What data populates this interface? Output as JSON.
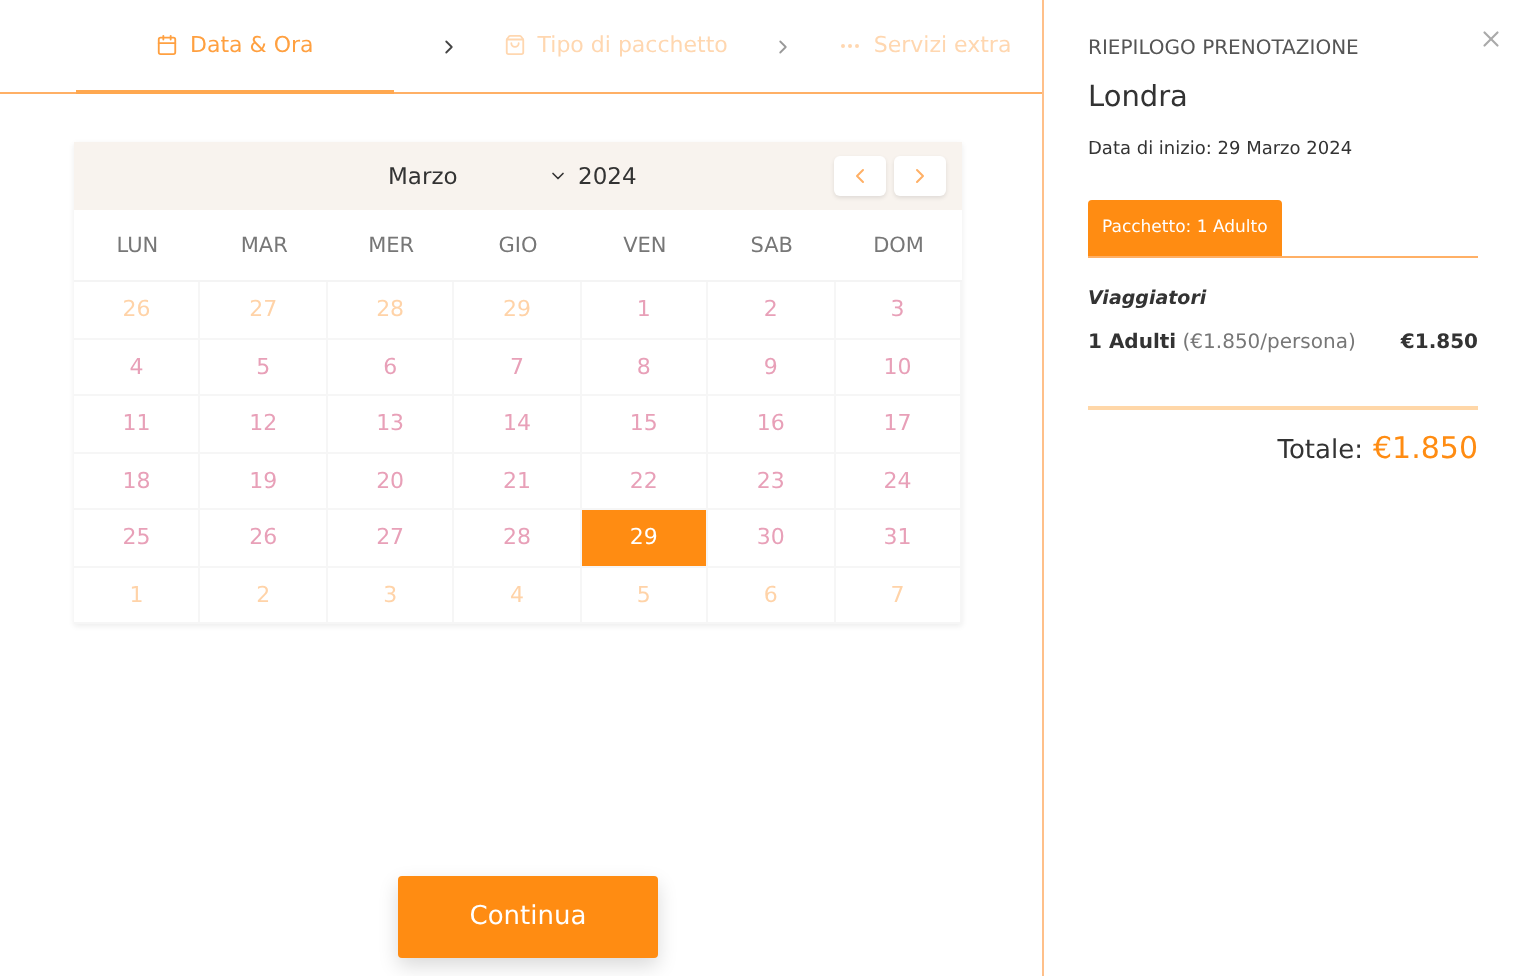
{
  "steps": [
    {
      "label": "Data & Ora",
      "kind": "calendar",
      "selected": true
    },
    {
      "label": "Tipo di pacchetto",
      "kind": "bag",
      "selected": false
    },
    {
      "label": "Servizi extra",
      "kind": "dots",
      "selected": false
    }
  ],
  "calendar": {
    "month": "Marzo",
    "year": "2024",
    "weekdays": [
      "LUN",
      "MAR",
      "MER",
      "GIO",
      "VEN",
      "SAB",
      "DOM"
    ],
    "weeks": [
      [
        {
          "day": "26",
          "outside": true,
          "selected": false
        },
        {
          "day": "27",
          "outside": true,
          "selected": false
        },
        {
          "day": "28",
          "outside": true,
          "selected": false
        },
        {
          "day": "29",
          "outside": true,
          "selected": false
        },
        {
          "day": "1",
          "outside": false,
          "selected": false
        },
        {
          "day": "2",
          "outside": false,
          "selected": false
        },
        {
          "day": "3",
          "outside": false,
          "selected": false
        }
      ],
      [
        {
          "day": "4",
          "outside": false,
          "selected": false
        },
        {
          "day": "5",
          "outside": false,
          "selected": false
        },
        {
          "day": "6",
          "outside": false,
          "selected": false
        },
        {
          "day": "7",
          "outside": false,
          "selected": false
        },
        {
          "day": "8",
          "outside": false,
          "selected": false
        },
        {
          "day": "9",
          "outside": false,
          "selected": false
        },
        {
          "day": "10",
          "outside": false,
          "selected": false
        }
      ],
      [
        {
          "day": "11",
          "outside": false,
          "selected": false
        },
        {
          "day": "12",
          "outside": false,
          "selected": false
        },
        {
          "day": "13",
          "outside": false,
          "selected": false
        },
        {
          "day": "14",
          "outside": false,
          "selected": false
        },
        {
          "day": "15",
          "outside": false,
          "selected": false
        },
        {
          "day": "16",
          "outside": false,
          "selected": false
        },
        {
          "day": "17",
          "outside": false,
          "selected": false
        }
      ],
      [
        {
          "day": "18",
          "outside": false,
          "selected": false
        },
        {
          "day": "19",
          "outside": false,
          "selected": false
        },
        {
          "day": "20",
          "outside": false,
          "selected": false
        },
        {
          "day": "21",
          "outside": false,
          "selected": false
        },
        {
          "day": "22",
          "outside": false,
          "selected": false
        },
        {
          "day": "23",
          "outside": false,
          "selected": false
        },
        {
          "day": "24",
          "outside": false,
          "selected": false
        }
      ],
      [
        {
          "day": "25",
          "outside": false,
          "selected": false
        },
        {
          "day": "26",
          "outside": false,
          "selected": false
        },
        {
          "day": "27",
          "outside": false,
          "selected": false
        },
        {
          "day": "28",
          "outside": false,
          "selected": false
        },
        {
          "day": "29",
          "outside": false,
          "selected": true
        },
        {
          "day": "30",
          "outside": false,
          "selected": false
        },
        {
          "day": "31",
          "outside": false,
          "selected": false
        }
      ],
      [
        {
          "day": "1",
          "outside": true,
          "selected": false
        },
        {
          "day": "2",
          "outside": true,
          "selected": false
        },
        {
          "day": "3",
          "outside": true,
          "selected": false
        },
        {
          "day": "4",
          "outside": true,
          "selected": false
        },
        {
          "day": "5",
          "outside": true,
          "selected": false
        },
        {
          "day": "6",
          "outside": true,
          "selected": false
        },
        {
          "day": "7",
          "outside": true,
          "selected": false
        }
      ]
    ]
  },
  "continue_button": "Continua",
  "summary": {
    "title": "RIEPILOGO PRENOTAZIONE",
    "destination": "Londra",
    "start_date": "Data di inizio: 29 Marzo 2024",
    "package_tab": "Pacchetto: 1 Adulto",
    "travelers_label": "Viaggiatori",
    "traveler_line": {
      "count": "1 Adulti",
      "unit_price": "(€1.850/persona)",
      "price": "€1.850"
    },
    "total_label": "Totale:",
    "total_value": "€1.850"
  }
}
